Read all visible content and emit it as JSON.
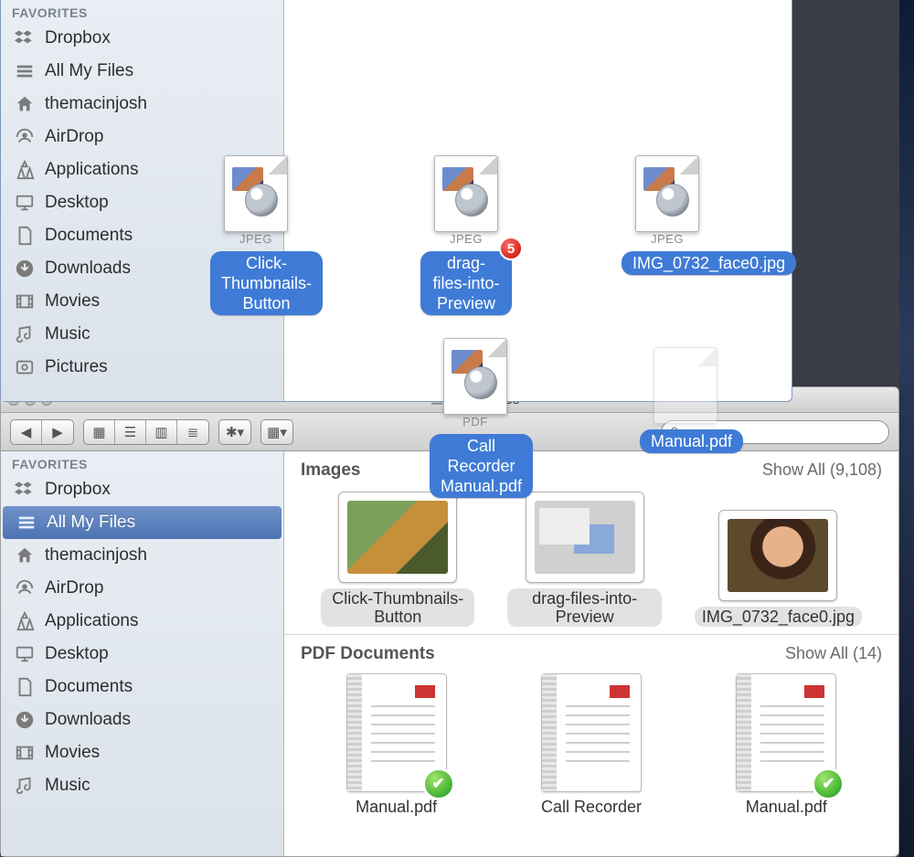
{
  "top_window": {
    "sidebar": {
      "header": "FAVORITES",
      "items": [
        {
          "label": "Dropbox",
          "icon": "dropbox"
        },
        {
          "label": "All My Files",
          "icon": "allfiles"
        },
        {
          "label": "themacinjosh",
          "icon": "home"
        },
        {
          "label": "AirDrop",
          "icon": "airdrop"
        },
        {
          "label": "Applications",
          "icon": "apps"
        },
        {
          "label": "Desktop",
          "icon": "desktop"
        },
        {
          "label": "Documents",
          "icon": "documents"
        },
        {
          "label": "Downloads",
          "icon": "downloads"
        },
        {
          "label": "Movies",
          "icon": "movies"
        },
        {
          "label": "Music",
          "icon": "music"
        },
        {
          "label": "Pictures",
          "icon": "pictures"
        }
      ]
    }
  },
  "drag": {
    "badge_count": "5",
    "items": [
      {
        "type": "JPEG",
        "label": "Click-Thumbnails-Button"
      },
      {
        "type": "JPEG",
        "label": "drag-files-into-Preview",
        "count": true
      },
      {
        "type": "JPEG",
        "label": "IMG_0732_face0.jpg"
      },
      {
        "type": "PDF",
        "label": "Call Recorder Manual.pdf"
      },
      {
        "type": "",
        "label": "Manual.pdf",
        "ghost": true
      }
    ]
  },
  "bottom_window": {
    "title": "All My Files",
    "sidebar": {
      "header": "FAVORITES",
      "selected_index": 1,
      "items": [
        {
          "label": "Dropbox",
          "icon": "dropbox"
        },
        {
          "label": "All My Files",
          "icon": "allfiles"
        },
        {
          "label": "themacinjosh",
          "icon": "home"
        },
        {
          "label": "AirDrop",
          "icon": "airdrop"
        },
        {
          "label": "Applications",
          "icon": "apps"
        },
        {
          "label": "Desktop",
          "icon": "desktop"
        },
        {
          "label": "Documents",
          "icon": "documents"
        },
        {
          "label": "Downloads",
          "icon": "downloads"
        },
        {
          "label": "Movies",
          "icon": "movies"
        },
        {
          "label": "Music",
          "icon": "music"
        }
      ]
    },
    "sections": {
      "images": {
        "title": "Images",
        "show_all": "Show All (9,108)",
        "items": [
          {
            "label": "Click-Thumbnails-Button",
            "kind": "green"
          },
          {
            "label": "drag-files-into-Preview",
            "kind": "screens"
          },
          {
            "label": "IMG_0732_face0.jpg",
            "kind": "face"
          }
        ]
      },
      "pdfs": {
        "title": "PDF Documents",
        "show_all": "Show All (14)",
        "items": [
          {
            "label": "Manual.pdf"
          },
          {
            "label": "Call Recorder"
          },
          {
            "label": "Manual.pdf"
          }
        ]
      }
    }
  }
}
